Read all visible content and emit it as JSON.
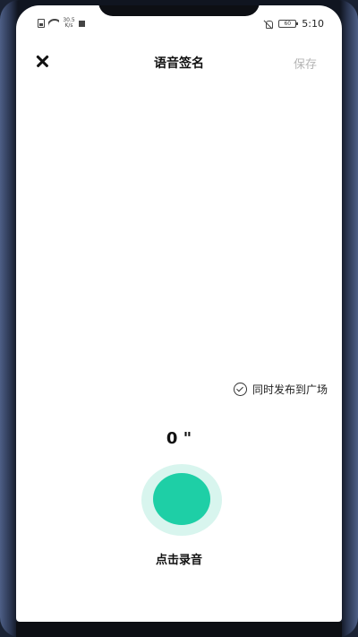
{
  "status_bar": {
    "net_speed_value": "30.5",
    "net_speed_unit": "K/s",
    "battery": "60",
    "time": "5:10"
  },
  "header": {
    "title": "语音签名",
    "save_label": "保存"
  },
  "options": {
    "sync_label": "同时发布到广场"
  },
  "recorder": {
    "timer": "0 \"",
    "record_label": "点击录音"
  },
  "colors": {
    "accent": "#1ecfa6",
    "accent_halo": "#d8f5ee",
    "disabled_text": "#b4b4b4"
  }
}
